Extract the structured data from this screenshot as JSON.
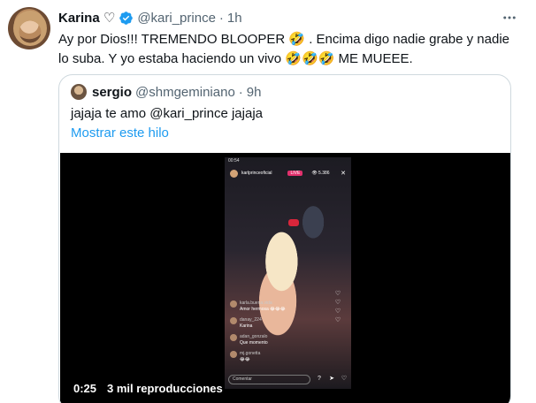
{
  "tweet": {
    "name": "Karina ♡",
    "handle": "@kari_prince",
    "separator": "·",
    "time": "1h",
    "more_icon": "more-horizontal-icon",
    "text_line1": "Ay por Dios!!! TREMENDO BLOOPER 🤣 . Encima digo nadie grabe y nadie",
    "text_line2": "lo suba. Y yo estaba haciendo un vivo 🤣🤣🤣 ME MUEEE."
  },
  "quote": {
    "name": "sergio",
    "handle": "@shmgeminiano",
    "separator": "·",
    "time": "9h",
    "text": "jajaja te amo  @kari_prince jajaja",
    "show_thread": "Mostrar este hilo"
  },
  "video": {
    "time": "0:25",
    "views": "3 mil reproducciones",
    "phone": {
      "status": "00:54",
      "username": "karlprinceoficial",
      "live_badge": "LIVE",
      "viewers": "👁 5.386",
      "close": "✕",
      "comments": [
        {
          "user": "karla.buena.vida",
          "text": "Amor hermosa 😂😂😂"
        },
        {
          "user": "danay_224",
          "text": "Karina"
        },
        {
          "user": "adan_gonzalo",
          "text": "Que momento"
        },
        {
          "user": "mj.gonetta",
          "text": "😂😂"
        }
      ],
      "input_placeholder": "Comentar"
    }
  },
  "colors": {
    "link": "#1d9bf0",
    "verified": "#1d9bf0",
    "secondary_text": "#536471",
    "border": "#cfd9de"
  }
}
